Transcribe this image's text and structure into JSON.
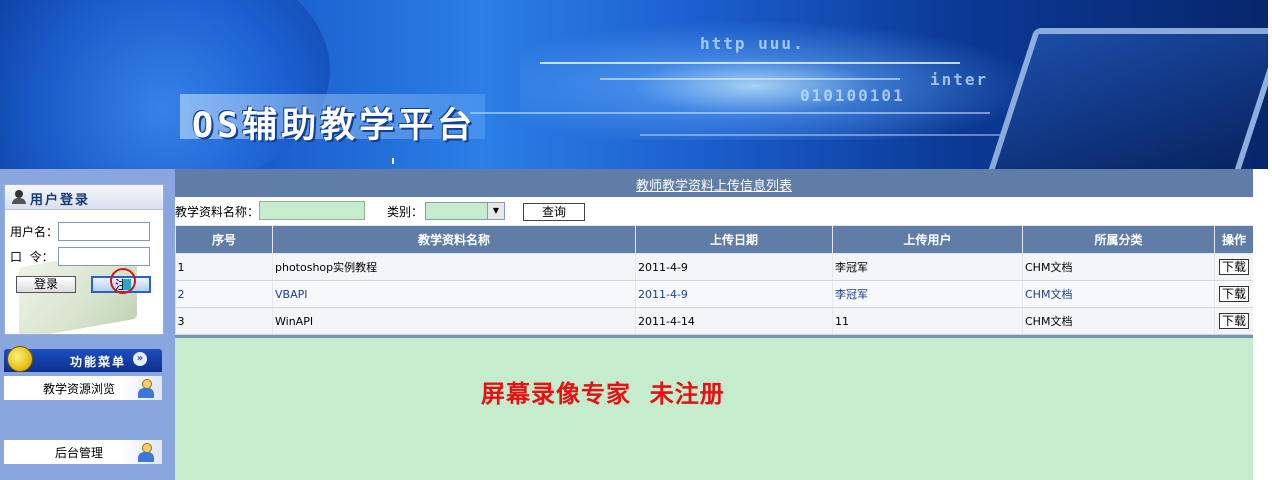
{
  "banner": {
    "title": "OS辅助教学平台",
    "bits_1": "http uuu.",
    "bits_2": "010100101",
    "bits_3": "inter"
  },
  "login": {
    "heading": "用户登录",
    "username_label": "用户名：",
    "password_label": "口  令：",
    "username_value": "",
    "password_value": "",
    "login_button": "登录",
    "register_button": "注"
  },
  "menu": {
    "heading": "功能菜单",
    "chevron": "»",
    "items": [
      {
        "label": "教学资源浏览"
      },
      {
        "label": "后台管理"
      }
    ]
  },
  "list": {
    "title": "教师教学资料上传信息列表",
    "search": {
      "name_label": "教学资料名称：",
      "name_value": "",
      "category_label": "类别：",
      "category_value": "",
      "query_button": "查询"
    },
    "columns": [
      "序号",
      "教学资料名称",
      "上传日期",
      "上传用户",
      "所属分类",
      "操作"
    ],
    "rows": [
      {
        "no": "1",
        "name": "photoshop实例教程",
        "date": "2011-4-9",
        "user": "李冠军",
        "category": "CHM文档",
        "action": "下载"
      },
      {
        "no": "2",
        "name": "VBAPI",
        "date": "2011-4-9",
        "user": "李冠军",
        "category": "CHM文档",
        "action": "下载"
      },
      {
        "no": "3",
        "name": "WinAPI",
        "date": "2011-4-14",
        "user": "11",
        "category": "CHM文档",
        "action": "下载"
      }
    ]
  },
  "watermark": "屏幕录像专家  未注册",
  "colors": {
    "header_bar": "#5f7da6",
    "main_bg": "#c5edcd",
    "sidebar_bg": "#8aa6de",
    "watermark": "#e41212"
  }
}
